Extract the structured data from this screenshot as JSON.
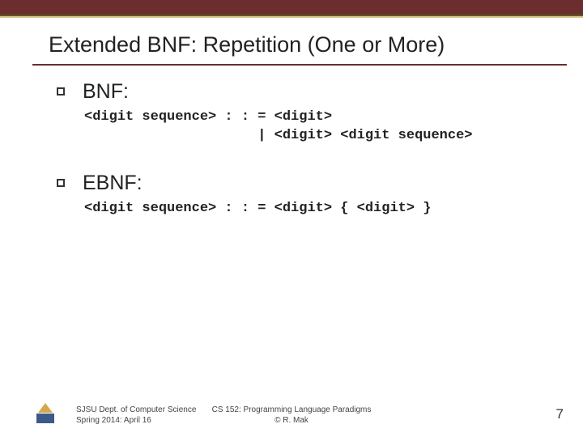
{
  "title": "Extended BNF: Repetition (One or More)",
  "items": [
    {
      "label": "BNF:",
      "code": "<digit sequence> : : = <digit>\n                     | <digit> <digit sequence>"
    },
    {
      "label": "EBNF:",
      "code": "<digit sequence> : : = <digit> { <digit> }"
    }
  ],
  "footer": {
    "left_line1": "SJSU Dept. of Computer Science",
    "left_line2": "Spring 2014: April 16",
    "center_line1": "CS 152: Programming Language Paradigms",
    "center_line2": "© R. Mak",
    "page_number": "7"
  }
}
